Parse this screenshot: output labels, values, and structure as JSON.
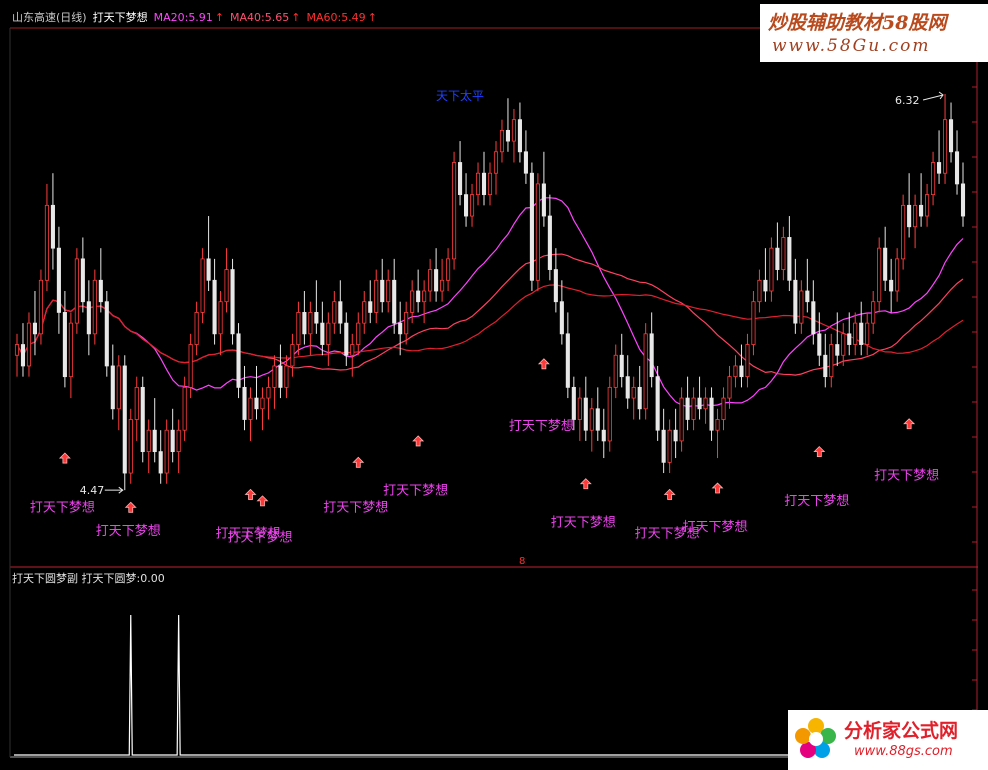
{
  "header": {
    "stock": "山东高速(日线)",
    "indicator": "打天下梦想",
    "ma20": "MA20:5.91",
    "ma40": "MA40:5.65",
    "ma60": "MA60:5.49",
    "ma_up_arrow": "↑",
    "colors": {
      "stock": "#c8c8c8",
      "indicator": "#ffffff",
      "ma20": "#ff44ff",
      "ma40": "#ff4060",
      "ma60": "#ff2020"
    }
  },
  "sub_panel": {
    "title": "打天下圆梦副",
    "value": "打天下圆梦:0.00"
  },
  "watermarks": {
    "top_line1": "炒股辅助教材58股网",
    "top_line2": "www.58Gu.com",
    "bottom_line1": "分析家公式网",
    "bottom_line2": "www.88gs.com"
  },
  "chart_data": {
    "type": "candlestick",
    "title": "",
    "xlabel": "",
    "ylabel": "",
    "ylim": [
      4.2,
      6.6
    ],
    "low_marker": {
      "index": 18,
      "value": "4.47"
    },
    "high_marker": {
      "index": 155,
      "value": "6.32"
    },
    "top_annotation": {
      "index": 75,
      "text": "天下太平"
    },
    "signal_label": "打天下梦想",
    "signals": [
      {
        "index": 8,
        "arrow_price": 4.62,
        "label_price": 4.37
      },
      {
        "index": 19,
        "arrow_price": 4.39,
        "label_price": 4.26
      },
      {
        "index": 39,
        "arrow_price": 4.45,
        "label_price": 4.25
      },
      {
        "index": 41,
        "arrow_price": 4.42,
        "label_price": 4.23
      },
      {
        "index": 57,
        "arrow_price": 4.6,
        "label_price": 4.37
      },
      {
        "index": 67,
        "arrow_price": 4.7,
        "label_price": 4.45
      },
      {
        "index": 88,
        "arrow_price": 5.06,
        "label_price": 4.75
      },
      {
        "index": 95,
        "arrow_price": 4.5,
        "label_price": 4.3
      },
      {
        "index": 109,
        "arrow_price": 4.45,
        "label_price": 4.25
      },
      {
        "index": 117,
        "arrow_price": 4.48,
        "label_price": 4.28
      },
      {
        "index": 134,
        "arrow_price": 4.65,
        "label_price": 4.4
      },
      {
        "index": 149,
        "arrow_price": 4.78,
        "label_price": 4.52
      }
    ],
    "candles": [
      {
        "o": 5.1,
        "h": 5.2,
        "l": 5.0,
        "c": 5.15
      },
      {
        "o": 5.15,
        "h": 5.25,
        "l": 5.0,
        "c": 5.05
      },
      {
        "o": 5.05,
        "h": 5.3,
        "l": 5.0,
        "c": 5.25
      },
      {
        "o": 5.25,
        "h": 5.4,
        "l": 5.1,
        "c": 5.2
      },
      {
        "o": 5.2,
        "h": 5.5,
        "l": 5.15,
        "c": 5.45
      },
      {
        "o": 5.45,
        "h": 5.9,
        "l": 5.4,
        "c": 5.8
      },
      {
        "o": 5.8,
        "h": 5.95,
        "l": 5.5,
        "c": 5.6
      },
      {
        "o": 5.6,
        "h": 5.7,
        "l": 5.2,
        "c": 5.3
      },
      {
        "o": 5.3,
        "h": 5.4,
        "l": 4.95,
        "c": 5.0
      },
      {
        "o": 5.0,
        "h": 5.3,
        "l": 4.9,
        "c": 5.25
      },
      {
        "o": 5.25,
        "h": 5.6,
        "l": 5.2,
        "c": 5.55
      },
      {
        "o": 5.55,
        "h": 5.65,
        "l": 5.3,
        "c": 5.35
      },
      {
        "o": 5.35,
        "h": 5.45,
        "l": 5.1,
        "c": 5.2
      },
      {
        "o": 5.2,
        "h": 5.5,
        "l": 5.15,
        "c": 5.45
      },
      {
        "o": 5.45,
        "h": 5.6,
        "l": 5.3,
        "c": 5.35
      },
      {
        "o": 5.35,
        "h": 5.4,
        "l": 5.0,
        "c": 5.05
      },
      {
        "o": 5.05,
        "h": 5.15,
        "l": 4.8,
        "c": 4.85
      },
      {
        "o": 4.85,
        "h": 5.1,
        "l": 4.75,
        "c": 5.05
      },
      {
        "o": 5.05,
        "h": 5.1,
        "l": 4.47,
        "c": 4.55
      },
      {
        "o": 4.55,
        "h": 4.85,
        "l": 4.5,
        "c": 4.8
      },
      {
        "o": 4.8,
        "h": 5.0,
        "l": 4.7,
        "c": 4.95
      },
      {
        "o": 4.95,
        "h": 5.0,
        "l": 4.6,
        "c": 4.65
      },
      {
        "o": 4.65,
        "h": 4.8,
        "l": 4.55,
        "c": 4.75
      },
      {
        "o": 4.75,
        "h": 4.9,
        "l": 4.6,
        "c": 4.65
      },
      {
        "o": 4.65,
        "h": 4.75,
        "l": 4.5,
        "c": 4.55
      },
      {
        "o": 4.55,
        "h": 4.8,
        "l": 4.5,
        "c": 4.75
      },
      {
        "o": 4.75,
        "h": 4.85,
        "l": 4.6,
        "c": 4.65
      },
      {
        "o": 4.65,
        "h": 4.8,
        "l": 4.55,
        "c": 4.75
      },
      {
        "o": 4.75,
        "h": 5.0,
        "l": 4.7,
        "c": 4.95
      },
      {
        "o": 4.95,
        "h": 5.2,
        "l": 4.9,
        "c": 5.15
      },
      {
        "o": 5.15,
        "h": 5.35,
        "l": 5.1,
        "c": 5.3
      },
      {
        "o": 5.3,
        "h": 5.6,
        "l": 5.25,
        "c": 5.55
      },
      {
        "o": 5.55,
        "h": 5.75,
        "l": 5.4,
        "c": 5.45
      },
      {
        "o": 5.45,
        "h": 5.55,
        "l": 5.15,
        "c": 5.2
      },
      {
        "o": 5.2,
        "h": 5.4,
        "l": 5.1,
        "c": 5.35
      },
      {
        "o": 5.35,
        "h": 5.6,
        "l": 5.3,
        "c": 5.5
      },
      {
        "o": 5.5,
        "h": 5.55,
        "l": 5.15,
        "c": 5.2
      },
      {
        "o": 5.2,
        "h": 5.25,
        "l": 4.9,
        "c": 4.95
      },
      {
        "o": 4.95,
        "h": 5.05,
        "l": 4.75,
        "c": 4.8
      },
      {
        "o": 4.8,
        "h": 4.95,
        "l": 4.7,
        "c": 4.9
      },
      {
        "o": 4.9,
        "h": 5.05,
        "l": 4.8,
        "c": 4.85
      },
      {
        "o": 4.85,
        "h": 4.95,
        "l": 4.75,
        "c": 4.9
      },
      {
        "o": 4.9,
        "h": 5.0,
        "l": 4.8,
        "c": 4.95
      },
      {
        "o": 4.95,
        "h": 5.1,
        "l": 4.85,
        "c": 5.05
      },
      {
        "o": 5.05,
        "h": 5.15,
        "l": 4.9,
        "c": 4.95
      },
      {
        "o": 4.95,
        "h": 5.1,
        "l": 4.9,
        "c": 5.05
      },
      {
        "o": 5.05,
        "h": 5.2,
        "l": 5.0,
        "c": 5.15
      },
      {
        "o": 5.15,
        "h": 5.35,
        "l": 5.1,
        "c": 5.3
      },
      {
        "o": 5.3,
        "h": 5.4,
        "l": 5.15,
        "c": 5.2
      },
      {
        "o": 5.2,
        "h": 5.35,
        "l": 5.1,
        "c": 5.3
      },
      {
        "o": 5.3,
        "h": 5.45,
        "l": 5.2,
        "c": 5.25
      },
      {
        "o": 5.25,
        "h": 5.35,
        "l": 5.1,
        "c": 5.15
      },
      {
        "o": 5.15,
        "h": 5.3,
        "l": 5.05,
        "c": 5.25
      },
      {
        "o": 5.25,
        "h": 5.4,
        "l": 5.2,
        "c": 5.35
      },
      {
        "o": 5.35,
        "h": 5.45,
        "l": 5.2,
        "c": 5.25
      },
      {
        "o": 5.25,
        "h": 5.3,
        "l": 5.05,
        "c": 5.1
      },
      {
        "o": 5.1,
        "h": 5.2,
        "l": 5.0,
        "c": 5.15
      },
      {
        "o": 5.15,
        "h": 5.3,
        "l": 5.1,
        "c": 5.25
      },
      {
        "o": 5.25,
        "h": 5.4,
        "l": 5.2,
        "c": 5.35
      },
      {
        "o": 5.35,
        "h": 5.45,
        "l": 5.25,
        "c": 5.3
      },
      {
        "o": 5.3,
        "h": 5.5,
        "l": 5.25,
        "c": 5.45
      },
      {
        "o": 5.45,
        "h": 5.55,
        "l": 5.3,
        "c": 5.35
      },
      {
        "o": 5.35,
        "h": 5.5,
        "l": 5.3,
        "c": 5.45
      },
      {
        "o": 5.45,
        "h": 5.55,
        "l": 5.2,
        "c": 5.25
      },
      {
        "o": 5.25,
        "h": 5.35,
        "l": 5.1,
        "c": 5.2
      },
      {
        "o": 5.2,
        "h": 5.35,
        "l": 5.15,
        "c": 5.3
      },
      {
        "o": 5.3,
        "h": 5.45,
        "l": 5.25,
        "c": 5.4
      },
      {
        "o": 5.4,
        "h": 5.5,
        "l": 5.3,
        "c": 5.35
      },
      {
        "o": 5.35,
        "h": 5.45,
        "l": 5.25,
        "c": 5.4
      },
      {
        "o": 5.4,
        "h": 5.55,
        "l": 5.35,
        "c": 5.5
      },
      {
        "o": 5.5,
        "h": 5.6,
        "l": 5.35,
        "c": 5.4
      },
      {
        "o": 5.4,
        "h": 5.55,
        "l": 5.35,
        "c": 5.45
      },
      {
        "o": 5.45,
        "h": 5.6,
        "l": 5.4,
        "c": 5.55
      },
      {
        "o": 5.55,
        "h": 6.05,
        "l": 5.5,
        "c": 6.0
      },
      {
        "o": 6.0,
        "h": 6.1,
        "l": 5.8,
        "c": 5.85
      },
      {
        "o": 5.85,
        "h": 5.95,
        "l": 5.7,
        "c": 5.75
      },
      {
        "o": 5.75,
        "h": 5.9,
        "l": 5.7,
        "c": 5.85
      },
      {
        "o": 5.85,
        "h": 6.0,
        "l": 5.8,
        "c": 5.95
      },
      {
        "o": 5.95,
        "h": 6.05,
        "l": 5.8,
        "c": 5.85
      },
      {
        "o": 5.85,
        "h": 6.0,
        "l": 5.8,
        "c": 5.95
      },
      {
        "o": 5.95,
        "h": 6.1,
        "l": 5.85,
        "c": 6.05
      },
      {
        "o": 6.05,
        "h": 6.2,
        "l": 6.0,
        "c": 6.15
      },
      {
        "o": 6.15,
        "h": 6.3,
        "l": 6.05,
        "c": 6.1
      },
      {
        "o": 6.1,
        "h": 6.25,
        "l": 6.0,
        "c": 6.2
      },
      {
        "o": 6.2,
        "h": 6.28,
        "l": 6.0,
        "c": 6.05
      },
      {
        "o": 6.05,
        "h": 6.15,
        "l": 5.9,
        "c": 5.95
      },
      {
        "o": 5.95,
        "h": 6.0,
        "l": 5.4,
        "c": 5.45
      },
      {
        "o": 5.45,
        "h": 5.95,
        "l": 5.4,
        "c": 5.9
      },
      {
        "o": 5.9,
        "h": 6.05,
        "l": 5.7,
        "c": 5.75
      },
      {
        "o": 5.75,
        "h": 5.85,
        "l": 5.45,
        "c": 5.5
      },
      {
        "o": 5.5,
        "h": 5.6,
        "l": 5.3,
        "c": 5.35
      },
      {
        "o": 5.35,
        "h": 5.45,
        "l": 5.15,
        "c": 5.2
      },
      {
        "o": 5.2,
        "h": 5.3,
        "l": 4.9,
        "c": 4.95
      },
      {
        "o": 4.95,
        "h": 5.0,
        "l": 4.75,
        "c": 4.8
      },
      {
        "o": 4.8,
        "h": 4.95,
        "l": 4.7,
        "c": 4.9
      },
      {
        "o": 4.9,
        "h": 5.0,
        "l": 4.7,
        "c": 4.75
      },
      {
        "o": 4.75,
        "h": 4.9,
        "l": 4.65,
        "c": 4.85
      },
      {
        "o": 4.85,
        "h": 4.95,
        "l": 4.7,
        "c": 4.75
      },
      {
        "o": 4.75,
        "h": 4.85,
        "l": 4.62,
        "c": 4.7
      },
      {
        "o": 4.7,
        "h": 5.0,
        "l": 4.65,
        "c": 4.95
      },
      {
        "o": 4.95,
        "h": 5.15,
        "l": 4.9,
        "c": 5.1
      },
      {
        "o": 5.1,
        "h": 5.2,
        "l": 4.95,
        "c": 5.0
      },
      {
        "o": 5.0,
        "h": 5.1,
        "l": 4.85,
        "c": 4.9
      },
      {
        "o": 4.9,
        "h": 5.0,
        "l": 4.8,
        "c": 4.95
      },
      {
        "o": 4.95,
        "h": 5.05,
        "l": 4.8,
        "c": 4.85
      },
      {
        "o": 4.85,
        "h": 5.25,
        "l": 4.8,
        "c": 5.2
      },
      {
        "o": 5.2,
        "h": 5.3,
        "l": 4.95,
        "c": 5.0
      },
      {
        "o": 5.0,
        "h": 5.05,
        "l": 4.7,
        "c": 4.75
      },
      {
        "o": 4.75,
        "h": 4.85,
        "l": 4.55,
        "c": 4.6
      },
      {
        "o": 4.6,
        "h": 4.8,
        "l": 4.55,
        "c": 4.75
      },
      {
        "o": 4.75,
        "h": 4.85,
        "l": 4.62,
        "c": 4.7
      },
      {
        "o": 4.7,
        "h": 4.95,
        "l": 4.65,
        "c": 4.9
      },
      {
        "o": 4.9,
        "h": 5.0,
        "l": 4.75,
        "c": 4.8
      },
      {
        "o": 4.8,
        "h": 4.95,
        "l": 4.75,
        "c": 4.9
      },
      {
        "o": 4.9,
        "h": 5.0,
        "l": 4.8,
        "c": 4.85
      },
      {
        "o": 4.85,
        "h": 4.95,
        "l": 4.78,
        "c": 4.9
      },
      {
        "o": 4.9,
        "h": 4.95,
        "l": 4.7,
        "c": 4.75
      },
      {
        "o": 4.75,
        "h": 4.85,
        "l": 4.62,
        "c": 4.8
      },
      {
        "o": 4.8,
        "h": 4.95,
        "l": 4.75,
        "c": 4.9
      },
      {
        "o": 4.9,
        "h": 5.05,
        "l": 4.85,
        "c": 5.0
      },
      {
        "o": 5.0,
        "h": 5.1,
        "l": 4.95,
        "c": 5.05
      },
      {
        "o": 5.05,
        "h": 5.15,
        "l": 4.95,
        "c": 5.0
      },
      {
        "o": 5.0,
        "h": 5.2,
        "l": 4.95,
        "c": 5.15
      },
      {
        "o": 5.15,
        "h": 5.4,
        "l": 5.1,
        "c": 5.35
      },
      {
        "o": 5.35,
        "h": 5.5,
        "l": 5.3,
        "c": 5.45
      },
      {
        "o": 5.45,
        "h": 5.6,
        "l": 5.35,
        "c": 5.4
      },
      {
        "o": 5.4,
        "h": 5.65,
        "l": 5.35,
        "c": 5.6
      },
      {
        "o": 5.6,
        "h": 5.72,
        "l": 5.45,
        "c": 5.5
      },
      {
        "o": 5.5,
        "h": 5.7,
        "l": 5.45,
        "c": 5.65
      },
      {
        "o": 5.65,
        "h": 5.75,
        "l": 5.4,
        "c": 5.45
      },
      {
        "o": 5.45,
        "h": 5.55,
        "l": 5.2,
        "c": 5.25
      },
      {
        "o": 5.25,
        "h": 5.45,
        "l": 5.2,
        "c": 5.4
      },
      {
        "o": 5.4,
        "h": 5.55,
        "l": 5.3,
        "c": 5.35
      },
      {
        "o": 5.35,
        "h": 5.45,
        "l": 5.15,
        "c": 5.2
      },
      {
        "o": 5.2,
        "h": 5.3,
        "l": 5.05,
        "c": 5.1
      },
      {
        "o": 5.1,
        "h": 5.2,
        "l": 4.95,
        "c": 5.0
      },
      {
        "o": 5.0,
        "h": 5.2,
        "l": 4.95,
        "c": 5.15
      },
      {
        "o": 5.15,
        "h": 5.3,
        "l": 5.05,
        "c": 5.1
      },
      {
        "o": 5.1,
        "h": 5.25,
        "l": 5.05,
        "c": 5.2
      },
      {
        "o": 5.2,
        "h": 5.3,
        "l": 5.1,
        "c": 5.15
      },
      {
        "o": 5.15,
        "h": 5.3,
        "l": 5.1,
        "c": 5.25
      },
      {
        "o": 5.25,
        "h": 5.35,
        "l": 5.1,
        "c": 5.15
      },
      {
        "o": 5.15,
        "h": 5.3,
        "l": 5.1,
        "c": 5.25
      },
      {
        "o": 5.25,
        "h": 5.4,
        "l": 5.2,
        "c": 5.35
      },
      {
        "o": 5.35,
        "h": 5.65,
        "l": 5.3,
        "c": 5.6
      },
      {
        "o": 5.6,
        "h": 5.7,
        "l": 5.4,
        "c": 5.45
      },
      {
        "o": 5.45,
        "h": 5.55,
        "l": 5.3,
        "c": 5.4
      },
      {
        "o": 5.4,
        "h": 5.6,
        "l": 5.35,
        "c": 5.55
      },
      {
        "o": 5.55,
        "h": 5.85,
        "l": 5.5,
        "c": 5.8
      },
      {
        "o": 5.8,
        "h": 5.95,
        "l": 5.65,
        "c": 5.7
      },
      {
        "o": 5.7,
        "h": 5.85,
        "l": 5.6,
        "c": 5.8
      },
      {
        "o": 5.8,
        "h": 5.95,
        "l": 5.7,
        "c": 5.75
      },
      {
        "o": 5.75,
        "h": 5.9,
        "l": 5.7,
        "c": 5.85
      },
      {
        "o": 5.85,
        "h": 6.05,
        "l": 5.8,
        "c": 6.0
      },
      {
        "o": 6.0,
        "h": 6.15,
        "l": 5.9,
        "c": 5.95
      },
      {
        "o": 5.95,
        "h": 6.32,
        "l": 5.9,
        "c": 6.2
      },
      {
        "o": 6.2,
        "h": 6.28,
        "l": 6.0,
        "c": 6.05
      },
      {
        "o": 6.05,
        "h": 6.15,
        "l": 5.85,
        "c": 5.9
      },
      {
        "o": 5.9,
        "h": 6.0,
        "l": 5.7,
        "c": 5.75
      }
    ],
    "ma_series": [
      {
        "name": "MA20",
        "period": 20,
        "color": "#ff44ff"
      },
      {
        "name": "MA40",
        "period": 40,
        "color": "#ff4060"
      },
      {
        "name": "MA60",
        "period": 60,
        "color": "#e02030"
      }
    ],
    "sub_spikes": [
      {
        "index": 19,
        "value": 1
      },
      {
        "index": 27,
        "value": 1
      }
    ]
  }
}
